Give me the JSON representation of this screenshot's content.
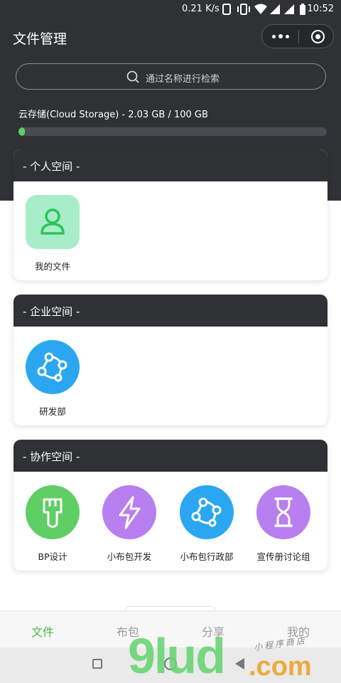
{
  "status_bar": {
    "speed": "0.21 K/s",
    "time": "10:52"
  },
  "header": {
    "title": "文件管理",
    "menu_icon": "more-dots-icon",
    "close_icon": "target-circle-icon"
  },
  "search": {
    "placeholder": "通过名称进行检索"
  },
  "storage": {
    "label": "云存储(Cloud Storage) - 2.03 GB / 100 GB",
    "used_fraction": 0.0203,
    "accent": "#5ccf63"
  },
  "sections": [
    {
      "title": "- 个人空间 -",
      "items": [
        {
          "label": "我的文件",
          "icon": "user-icon",
          "color": "#a8edc9"
        }
      ]
    },
    {
      "title": "- 企业空间 -",
      "items": [
        {
          "label": "研发部",
          "icon": "network-nodes-icon",
          "color": "#2ba7f2"
        }
      ]
    },
    {
      "title": "- 协作空间 -",
      "items": [
        {
          "label": "BP设计",
          "icon": "paint-brush-icon",
          "color": "#5fce64"
        },
        {
          "label": "小布包开发",
          "icon": "lightning-icon",
          "color": "#b77ff0"
        },
        {
          "label": "小布包行政部",
          "icon": "network-nodes-icon",
          "color": "#2ba7f2"
        },
        {
          "label": "宣传册讨论组",
          "icon": "hourglass-icon",
          "color": "#b77ff0"
        }
      ]
    }
  ],
  "tabs": [
    {
      "label": "文件",
      "active": true
    },
    {
      "label": "布包",
      "active": false
    },
    {
      "label": "分享",
      "active": false
    },
    {
      "label": "我的",
      "active": false
    }
  ],
  "watermark": {
    "main": "9lud",
    "suffix": ".com",
    "sub": "小程序商店"
  }
}
